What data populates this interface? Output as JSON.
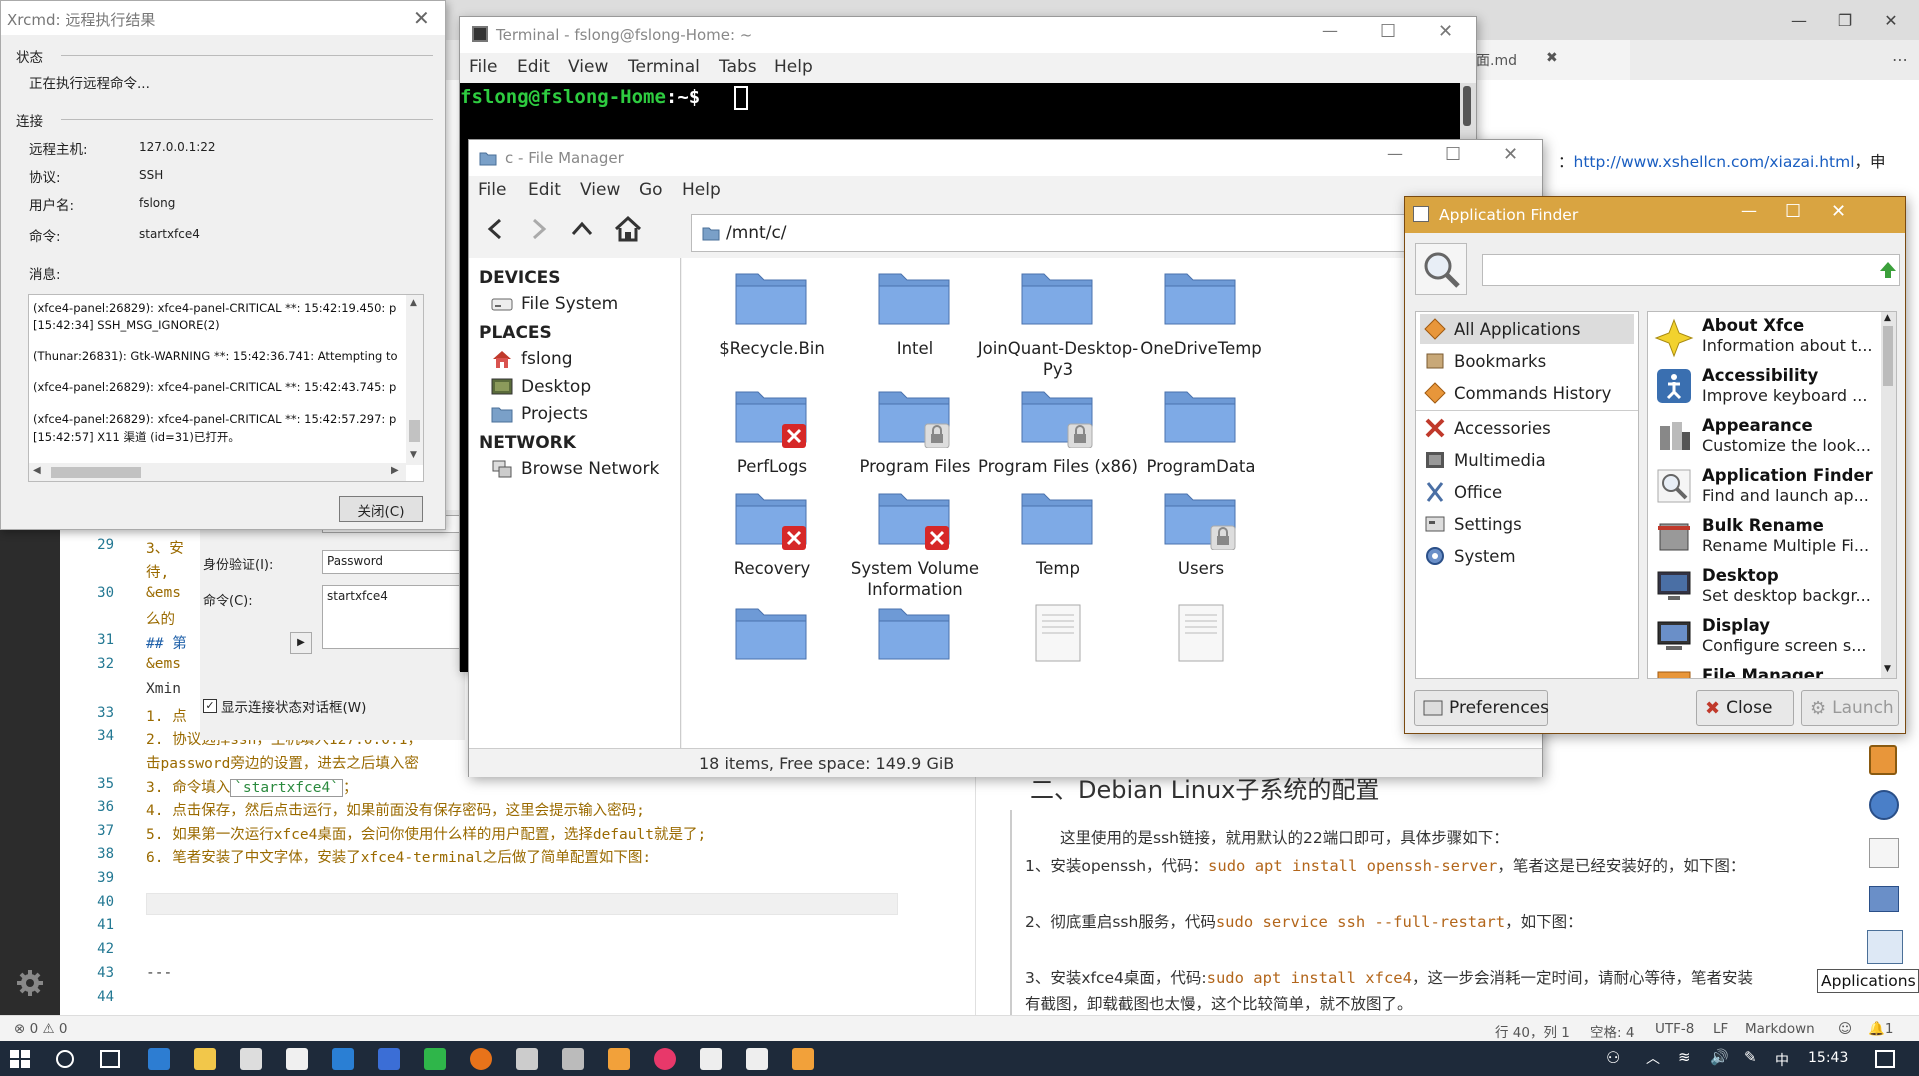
{
  "vscode": {
    "title": "",
    "tab_label": "界面.md",
    "line_numbers": [
      "29",
      "30",
      "31",
      "32",
      "33",
      "34",
      "35",
      "36",
      "37",
      "38",
      "39",
      "40",
      "41",
      "42",
      "43",
      "44"
    ],
    "lines": {
      "l29a": "3、安",
      "l29b": "待,",
      "l30a": "&ems",
      "l30b": "么的",
      "l31": "## 第",
      "l32a": "&ems",
      "l32b": "Xmin",
      "l33": "1. 点",
      "l34a": "2. 协议选择ssh，主机填入127.0.0.1，",
      "l34b": "击password旁边的设置，进去之后填入密",
      "l35_pre": "3. 命令填入",
      "l35_code": "`startxfce4`",
      "l35_post": "；",
      "l36": "4. 点击保存，然后点击运行，如果前面没有保存密码，这里会提示输入密码;",
      "l37": "5. 如果第一次运行xfce4桌面，会问你使用什么样的用户配置，选择default就是了;",
      "l38": "6. 笔者安装了中文字体，安装了xfce4-terminal之后做了简单配置如下图:",
      "l43": "---"
    },
    "preview": {
      "link_prefix": "：",
      "link": "http://www.xshellcn.com/xiazai.html",
      "link_suffix": "，申",
      "heading": "二、Debian Linux子系统的配置",
      "p1": "这里使用的是ssh链接，就用默认的22端口即可，具体步骤如下：",
      "p2_pre": "1、安装openssh，代码：",
      "p2_code": "sudo apt install openssh-server",
      "p2_post": "，笔者这是已经安装好的，如下图：",
      "p3_pre": "2、彻底重启ssh服务，代码",
      "p3_code": "sudo service ssh --full-restart",
      "p3_post": "，如下图：",
      "p4_pre": "3、安装xfce4桌面，代码:",
      "p4_code": "sudo apt install xfce4",
      "p4_post": "，这一步会消耗一定时间，请耐心等待，笔者安装",
      "p5": "有截图，卸载截图也太慢，这个比较简单，就不放图了。"
    },
    "status": {
      "errors": "0",
      "warnings": "0",
      "position": "行 40，列 1",
      "spaces": "空格: 4",
      "encoding": "UTF-8",
      "eol": "LF",
      "language": "Markdown",
      "notifications": "1"
    }
  },
  "xrcmd": {
    "title": "Xrcmd: 远程执行结果",
    "status_label": "状态",
    "status_text": "正在执行远程命令...",
    "connect_label": "连接",
    "host_label": "远程主机:",
    "host_value": "127.0.0.1:22",
    "protocol_label": "协议:",
    "protocol_value": "SSH",
    "user_label": "用户名:",
    "user_value": "fslong",
    "command_label": "命令:",
    "command_value": "startxfce4",
    "message_label": "消息:",
    "log": [
      "(xfce4-panel:26829): xfce4-panel-CRITICAL **: 15:42:19.450: p",
      "[15:42:34]          SSH_MSG_IGNORE(2)",
      "(Thunar:26831): Gtk-WARNING **: 15:42:36.741: Attempting to",
      "(xfce4-panel:26829): xfce4-panel-CRITICAL **: 15:42:43.745: p",
      "(xfce4-panel:26829): xfce4-panel-CRITICAL **: 15:42:57.297: p",
      "[15:42:57] X11 渠道 (id=31)已打开。"
    ],
    "close_button": "关闭(C)"
  },
  "xshell_partial": {
    "auth_label": "身份验证(I):",
    "auth_value": "Password",
    "command_label": "命令(C):",
    "command_value": "startxfce4",
    "checkbox_label": "显示连接状态对话框(W)",
    "checkbox_checked": true
  },
  "terminal": {
    "title": "Terminal - fslong@fslong-Home: ~",
    "menu": [
      "File",
      "Edit",
      "View",
      "Terminal",
      "Tabs",
      "Help"
    ],
    "prompt_user": "fslong@fslong-Home",
    "prompt_rest": ":~$ ",
    "prompt_color": "#2ecc40"
  },
  "file_manager": {
    "title": "c - File Manager",
    "menu": [
      "File",
      "Edit",
      "View",
      "Go",
      "Help"
    ],
    "path": "/mnt/c/",
    "sections": {
      "devices": "DEVICES",
      "places": "PLACES",
      "network": "NETWORK"
    },
    "devices": [
      "File System"
    ],
    "places": [
      "fslong",
      "Desktop",
      "Projects"
    ],
    "network": [
      "Browse Network"
    ],
    "items": [
      {
        "name": "$Recycle.Bin",
        "badge": ""
      },
      {
        "name": "Intel",
        "badge": ""
      },
      {
        "name": "JoinQuant-Desktop-Py3",
        "badge": ""
      },
      {
        "name": "OneDriveTemp",
        "badge": ""
      },
      {
        "name": "PerfLogs",
        "badge": "x"
      },
      {
        "name": "Program Files",
        "badge": "lock"
      },
      {
        "name": "Program Files (x86)",
        "badge": "lock"
      },
      {
        "name": "ProgramData",
        "badge": ""
      },
      {
        "name": "Recovery",
        "badge": "x"
      },
      {
        "name": "System Volume Information",
        "badge": "x"
      },
      {
        "name": "Temp",
        "badge": ""
      },
      {
        "name": "Users",
        "badge": "lock"
      }
    ],
    "status": "18 items, Free space: 149.9 GiB"
  },
  "app_finder": {
    "title": "Application Finder",
    "categories": [
      "All Applications",
      "Bookmarks",
      "Commands History",
      "Accessories",
      "Multimedia",
      "Office",
      "Settings",
      "System"
    ],
    "apps": [
      {
        "name": "About Xfce",
        "desc": "Information about t..."
      },
      {
        "name": "Accessibility",
        "desc": "Improve keyboard ..."
      },
      {
        "name": "Appearance",
        "desc": "Customize the look..."
      },
      {
        "name": "Application Finder",
        "desc": "Find and launch ap..."
      },
      {
        "name": "Bulk Rename",
        "desc": "Rename Multiple Fi..."
      },
      {
        "name": "Desktop",
        "desc": "Set desktop backgr..."
      },
      {
        "name": "Display",
        "desc": "Configure screen s..."
      },
      {
        "name": "File Manager",
        "desc": ""
      }
    ],
    "preferences_button": "Preferences",
    "close_button": "Close",
    "launch_button": "Launch"
  },
  "tooltip": "Applications",
  "taskbar": {
    "lang": "中",
    "time": "15:43"
  }
}
